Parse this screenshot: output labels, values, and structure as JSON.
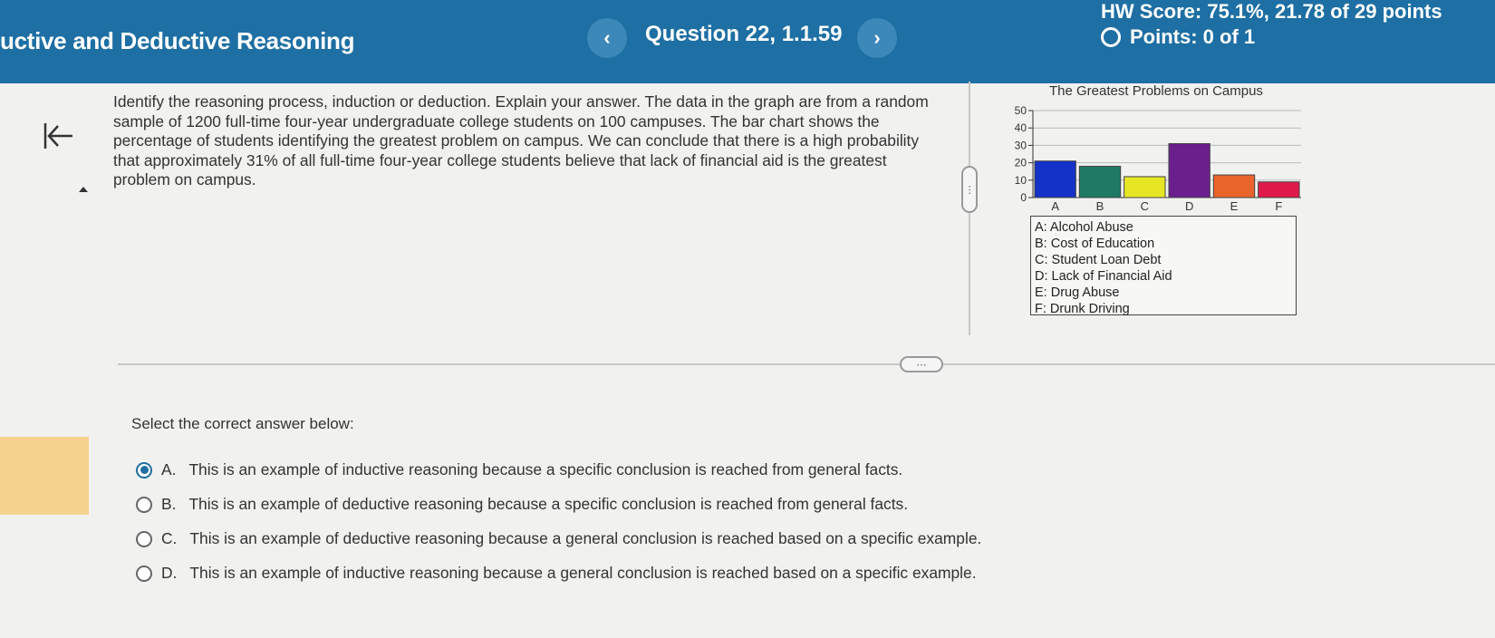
{
  "header": {
    "title": "uctive and Deductive Reasoning",
    "question_label": "Question 22, 1.1.59",
    "prev_glyph": "‹",
    "next_glyph": "›",
    "hw_score": "HW Score: 75.1%, 21.78 of 29 points",
    "points": "Points: 0 of 1",
    "color": "#1e6fa3"
  },
  "question": {
    "text": "Identify the reasoning process, induction or deduction. Explain your answer. The data in the graph are from a random sample of 1200 full-time four-year undergraduate college students on 100 campuses. The bar chart shows the percentage of students identifying the greatest problem on campus. We can conclude that there is a high probability that approximately 31% of all full-time four-year college students believe that lack of financial aid is the greatest problem on campus."
  },
  "splitter_glyph": "⋯",
  "chart_data": {
    "type": "bar",
    "title": "The Greatest Problems on Campus",
    "categories": [
      "A",
      "B",
      "C",
      "D",
      "E",
      "F"
    ],
    "values": [
      21,
      18,
      12,
      31,
      13,
      9
    ],
    "colors": [
      "#1432c8",
      "#1f7a63",
      "#e6e625",
      "#6b1f8c",
      "#e8642a",
      "#e0194b"
    ],
    "yticks": [
      0,
      10,
      20,
      30,
      40,
      50
    ],
    "ylim": [
      0,
      50
    ],
    "legend": [
      "A: Alcohol Abuse",
      "B: Cost of Education",
      "C: Student Loan Debt",
      "D: Lack of Financial Aid",
      "E: Drug Abuse",
      "F: Drunk Driving"
    ]
  },
  "answers": {
    "prompt": "Select the correct answer below:",
    "options": [
      {
        "letter": "A.",
        "text": "This is an example of inductive reasoning because a specific conclusion is reached from general facts.",
        "selected": true
      },
      {
        "letter": "B.",
        "text": "This is an example of deductive reasoning because a specific conclusion is reached from general facts.",
        "selected": false
      },
      {
        "letter": "C.",
        "text": "This is an example of deductive reasoning because a general conclusion is reached based on a specific example.",
        "selected": false
      },
      {
        "letter": "D.",
        "text": "This is an example of inductive reasoning because a general conclusion is reached based on a specific example.",
        "selected": false
      }
    ]
  }
}
